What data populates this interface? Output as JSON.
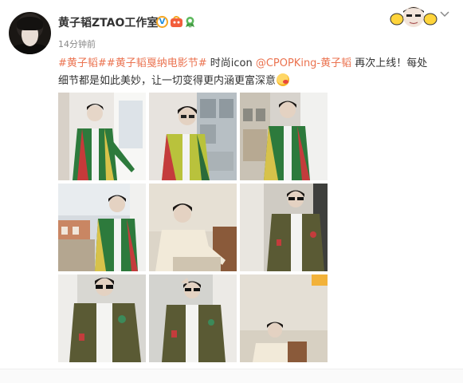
{
  "post": {
    "author": "黄子韬ZTAO工作室",
    "verified_mark": "V",
    "timestamp": "14分钟前",
    "dropdown_icon": "chevron-down-icon",
    "text": {
      "topic1": "#黄子韬#",
      "topic2": "#黄子韬戛纳电影节#",
      "plain1": " 时尚icon ",
      "mention": "@CPOPKing-黄子韬",
      "plain2": " 再次上线！每处细节都是如此美妙，让一切变得更内涵更富深意"
    }
  },
  "colors": {
    "accent": "#eb7350",
    "text": "#333333",
    "muted": "#888888"
  },
  "photos": [
    {
      "label": "photo-1"
    },
    {
      "label": "photo-2"
    },
    {
      "label": "photo-3"
    },
    {
      "label": "photo-4"
    },
    {
      "label": "photo-5"
    },
    {
      "label": "photo-6"
    },
    {
      "label": "photo-7"
    },
    {
      "label": "photo-8"
    },
    {
      "label": "photo-9"
    }
  ]
}
